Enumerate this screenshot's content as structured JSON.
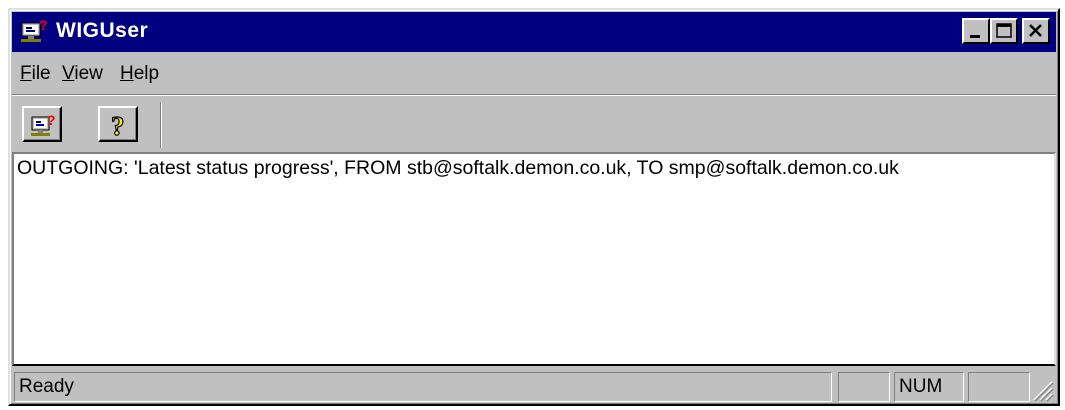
{
  "window": {
    "title": "WIGUser",
    "app_icon": "computer-question-icon",
    "controls": [
      "minimize-icon",
      "maximize-icon",
      "close-icon"
    ]
  },
  "menu": {
    "items": [
      {
        "label": "File",
        "mnemonic": "F"
      },
      {
        "label": "View",
        "mnemonic": "V"
      },
      {
        "label": "Help",
        "mnemonic": "H"
      }
    ]
  },
  "toolbar": {
    "buttons": [
      {
        "icon": "computer-question-icon"
      },
      {
        "icon": "question-mark-icon"
      }
    ]
  },
  "log": {
    "lines": [
      "OUTGOING: 'Latest status progress', FROM stb@softalk.demon.co.uk, TO smp@softalk.demon.co.uk"
    ]
  },
  "status": {
    "text": "Ready",
    "num": "NUM"
  },
  "colors": {
    "titlebar": "#000080",
    "face": "#c0c0c0",
    "content_bg": "#ffffff"
  }
}
